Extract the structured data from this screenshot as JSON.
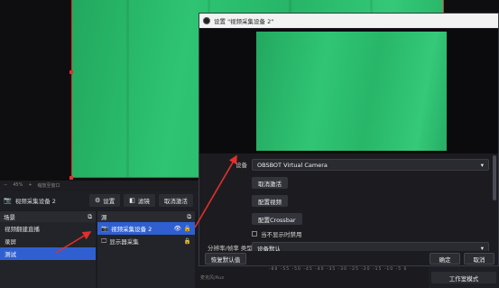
{
  "main": {
    "zoom_bar": {
      "zoom": "45%",
      "extra": "缩放至窗口"
    }
  },
  "toolbar": {
    "source_name": "视频采集设备 2",
    "settings_label": "设置",
    "filters_label": "滤镜",
    "deactivate_label": "取消激活"
  },
  "scenes": {
    "header": "场景",
    "items": [
      "视频翻建直播",
      "录屏",
      "测试"
    ],
    "active_index": 2
  },
  "sources": {
    "header": "源",
    "items": [
      {
        "name": "视频采集设备 2",
        "icon": "camera-icon"
      },
      {
        "name": "显示器采集",
        "icon": "monitor-icon"
      }
    ]
  },
  "dialog": {
    "title": "设置 \"视频采集设备 2\"",
    "device_label": "设备",
    "device_value": "OBSBOT Virtual Camera",
    "btn_deactivate": "取消激活",
    "btn_config_video": "配置视频",
    "btn_config_crossbar": "配置Crossbar",
    "checkbox_label": "当不显示时禁用",
    "resolution_label": "分辨率/帧率 类型",
    "resolution_value": "设备默认",
    "restore_defaults": "恢复默认值",
    "ok_label": "确定",
    "cancel_label": "取消"
  },
  "bottom": {
    "mixer_label": "麦克风/Aux",
    "mixer_ticks": "-60 -55 -50 -45 -40 -35 -30 -25 -20 -15 -10 -5 0",
    "studio_mode": "工作室模式"
  },
  "colors": {
    "accent": "#2f5fd0",
    "selection_border": "#e0302a",
    "green_screen": "#2ec473"
  }
}
